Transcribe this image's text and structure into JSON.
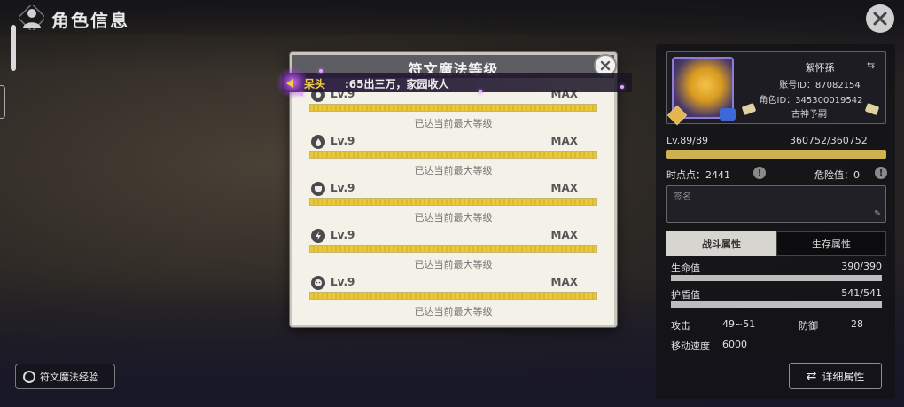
{
  "header": {
    "title": "角色信息"
  },
  "modal": {
    "title": "符文魔法等级",
    "runes": [
      {
        "icon": "rune-1-icon",
        "level": "Lv.9",
        "max_label": "MAX",
        "progress": 1.0,
        "status": "已达当前最大等级"
      },
      {
        "icon": "flame-rune-icon",
        "level": "Lv.9",
        "max_label": "MAX",
        "progress": 1.0,
        "status": "已达当前最大等级"
      },
      {
        "icon": "shield-rune-icon",
        "level": "Lv.9",
        "max_label": "MAX",
        "progress": 1.0,
        "status": "已达当前最大等级"
      },
      {
        "icon": "lightning-rune-icon",
        "level": "Lv.9",
        "max_label": "MAX",
        "progress": 1.0,
        "status": "已达当前最大等级"
      },
      {
        "icon": "face-rune-icon",
        "level": "Lv.9",
        "max_label": "MAX",
        "progress": 1.0,
        "status": "已达当前最大等级"
      }
    ]
  },
  "chat": {
    "name": "呆头",
    "message": ":65出三万，家园收人"
  },
  "profile": {
    "name": "絮怀孫",
    "account_id": "账号ID：87082154",
    "role_id": "角色ID：345300019542",
    "title": "古神予嗣",
    "level": "Lv.89/89",
    "exp": "360752/360752",
    "exp_progress": 1.0,
    "time_points": "时点点：2441",
    "danger": "危险值：0",
    "nickname_placeholder": "签名"
  },
  "tabs": {
    "combat": "战斗属性",
    "survival": "生存属性"
  },
  "stats": {
    "hp_label": "生命值",
    "hp_value": "390/390",
    "hp_progress": 1.0,
    "shield_label": "护盾值",
    "shield_value": "541/541",
    "shield_progress": 1.0,
    "attack_label": "攻击",
    "attack_value": "49~51",
    "defense_label": "防御",
    "defense_value": "28",
    "speed_label": "移动速度",
    "speed_value": "6000"
  },
  "buttons": {
    "detail": "详细属性",
    "rune_exp": "符文魔法经验"
  },
  "colors": {
    "accent_gold": "#e9c83c",
    "chat_name": "#f5d040",
    "modal_header": "#5d5c63"
  }
}
